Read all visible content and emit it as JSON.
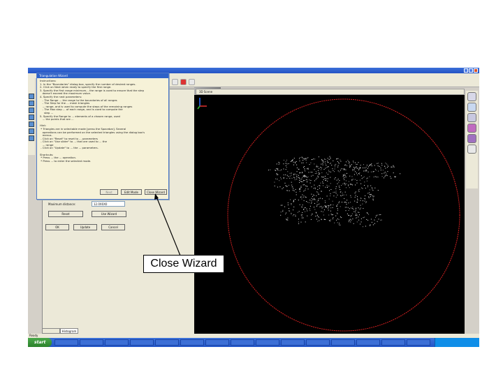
{
  "window": {
    "title": "",
    "status": "Ready"
  },
  "canvas": {
    "tab_label": "3D Scene"
  },
  "panel": {
    "tabs": [
      "",
      "Histogram"
    ],
    "field_label": "Maximum distance:",
    "field_value": "12.0X0X0",
    "buttons": [
      "Reset",
      "Use Wizard",
      "OK",
      "Update",
      "Cancel"
    ]
  },
  "wizard_dialog": {
    "title": "Triangulation Wizard",
    "instructions": "Instructions:\n1. In the \"Boundaries\" dialog box, specify the number of desired ranges.\n2. Click on Next when ready to specify the first range.\n3. Specify the first range minimum... the range is used to ensure that the step\n   doesn't exceed the maximum value.\n4. Specify the next parameters:\n   - The Range ... the range to the boundaries of all ranges\n   - The Step for the ... mesh triangles\n   ... range, and is used to compute the steps of the remaining ranges\n   - The Max step ... of each range, and is used to compute the\n     step ...\n5. Specify the Range to ... elements of a chosen range, used\n   ... the points that are ...\n\nHint:\n * Triangles are in selectable mode [press the Spacebar]. Several\n   operations can be performed on the selected triangles using the dialog box's\n   menus.\n - Click on \"Reset\" to reset to ... parameters\n - Click on \"Use slider\" to ... that are used to ... the\n   ... range\n - Click on \"Update\" to ... the ... parameters.\n\nShortcuts:\n * Press ... the ... operation.\n * Press ... to enter the selected mode.",
    "buttons": [
      "Next",
      "Edit Mode",
      "Close Wizard"
    ]
  },
  "taskbar": {
    "start_label": "start",
    "tasks": [
      "",
      "",
      "",
      "",
      "",
      "",
      "",
      "",
      "",
      "",
      "",
      "",
      "",
      "",
      ""
    ]
  },
  "annotation": {
    "callout_text": "Close Wizard"
  },
  "colors": {
    "circle_stroke": "#d42020",
    "titlebar": "#2452c4",
    "canvas_bg": "#000000"
  }
}
